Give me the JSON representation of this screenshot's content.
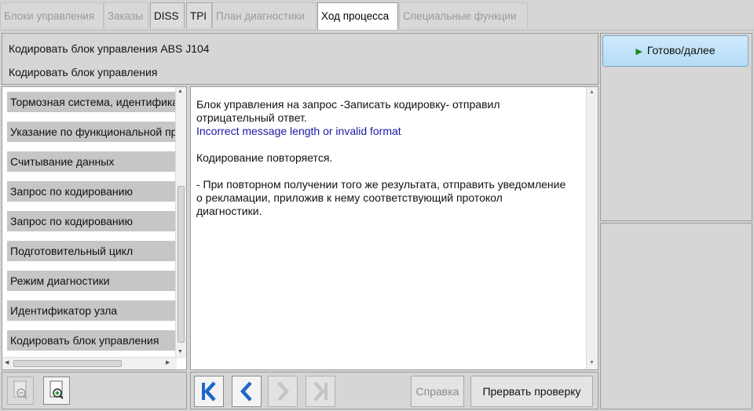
{
  "tabs": [
    {
      "label": "Блоки управления",
      "state": "disabled"
    },
    {
      "label": "Заказы",
      "state": "disabled"
    },
    {
      "label": "DISS",
      "state": "enabled"
    },
    {
      "label": "TPI",
      "state": "enabled"
    },
    {
      "label": "План диагностики",
      "state": "disabled"
    },
    {
      "label": "Ход процесса",
      "state": "active"
    },
    {
      "label": "Специальные функции",
      "state": "disabled"
    }
  ],
  "header": {
    "line1": "Кодировать блок управления ABS J104",
    "line2": "Кодировать блок управления"
  },
  "steps": [
    "Тормозная система, идентификация",
    "Указание по функциональной проверке",
    "Считывание данных",
    "Запрос по кодированию",
    "Запрос по кодированию",
    "Подготовительный цикл",
    "Режим диагностики",
    "Идентификатор узла",
    "Кодировать блок управления"
  ],
  "message": {
    "p1_line1": "Блок управления на запрос -Записать кодировку- отправил",
    "p1_line2": "отрицательный ответ.",
    "error": "Incorrect message length or invalid format",
    "p2": "Кодирование повторяется.",
    "p3_line1": "- При повторном получении того же результата, отправить уведомление",
    "p3_line2": "о рекламации, приложив к нему соответствующий протокол",
    "p3_line3": "диагностики."
  },
  "buttons": {
    "next": "Готово/далее",
    "help": "Справка",
    "abort": "Прервать проверку"
  },
  "colors": {
    "accent_blue": "#1a1aa6",
    "next_button": "#b4dcf6",
    "nav_blue": "#1e66c8"
  }
}
